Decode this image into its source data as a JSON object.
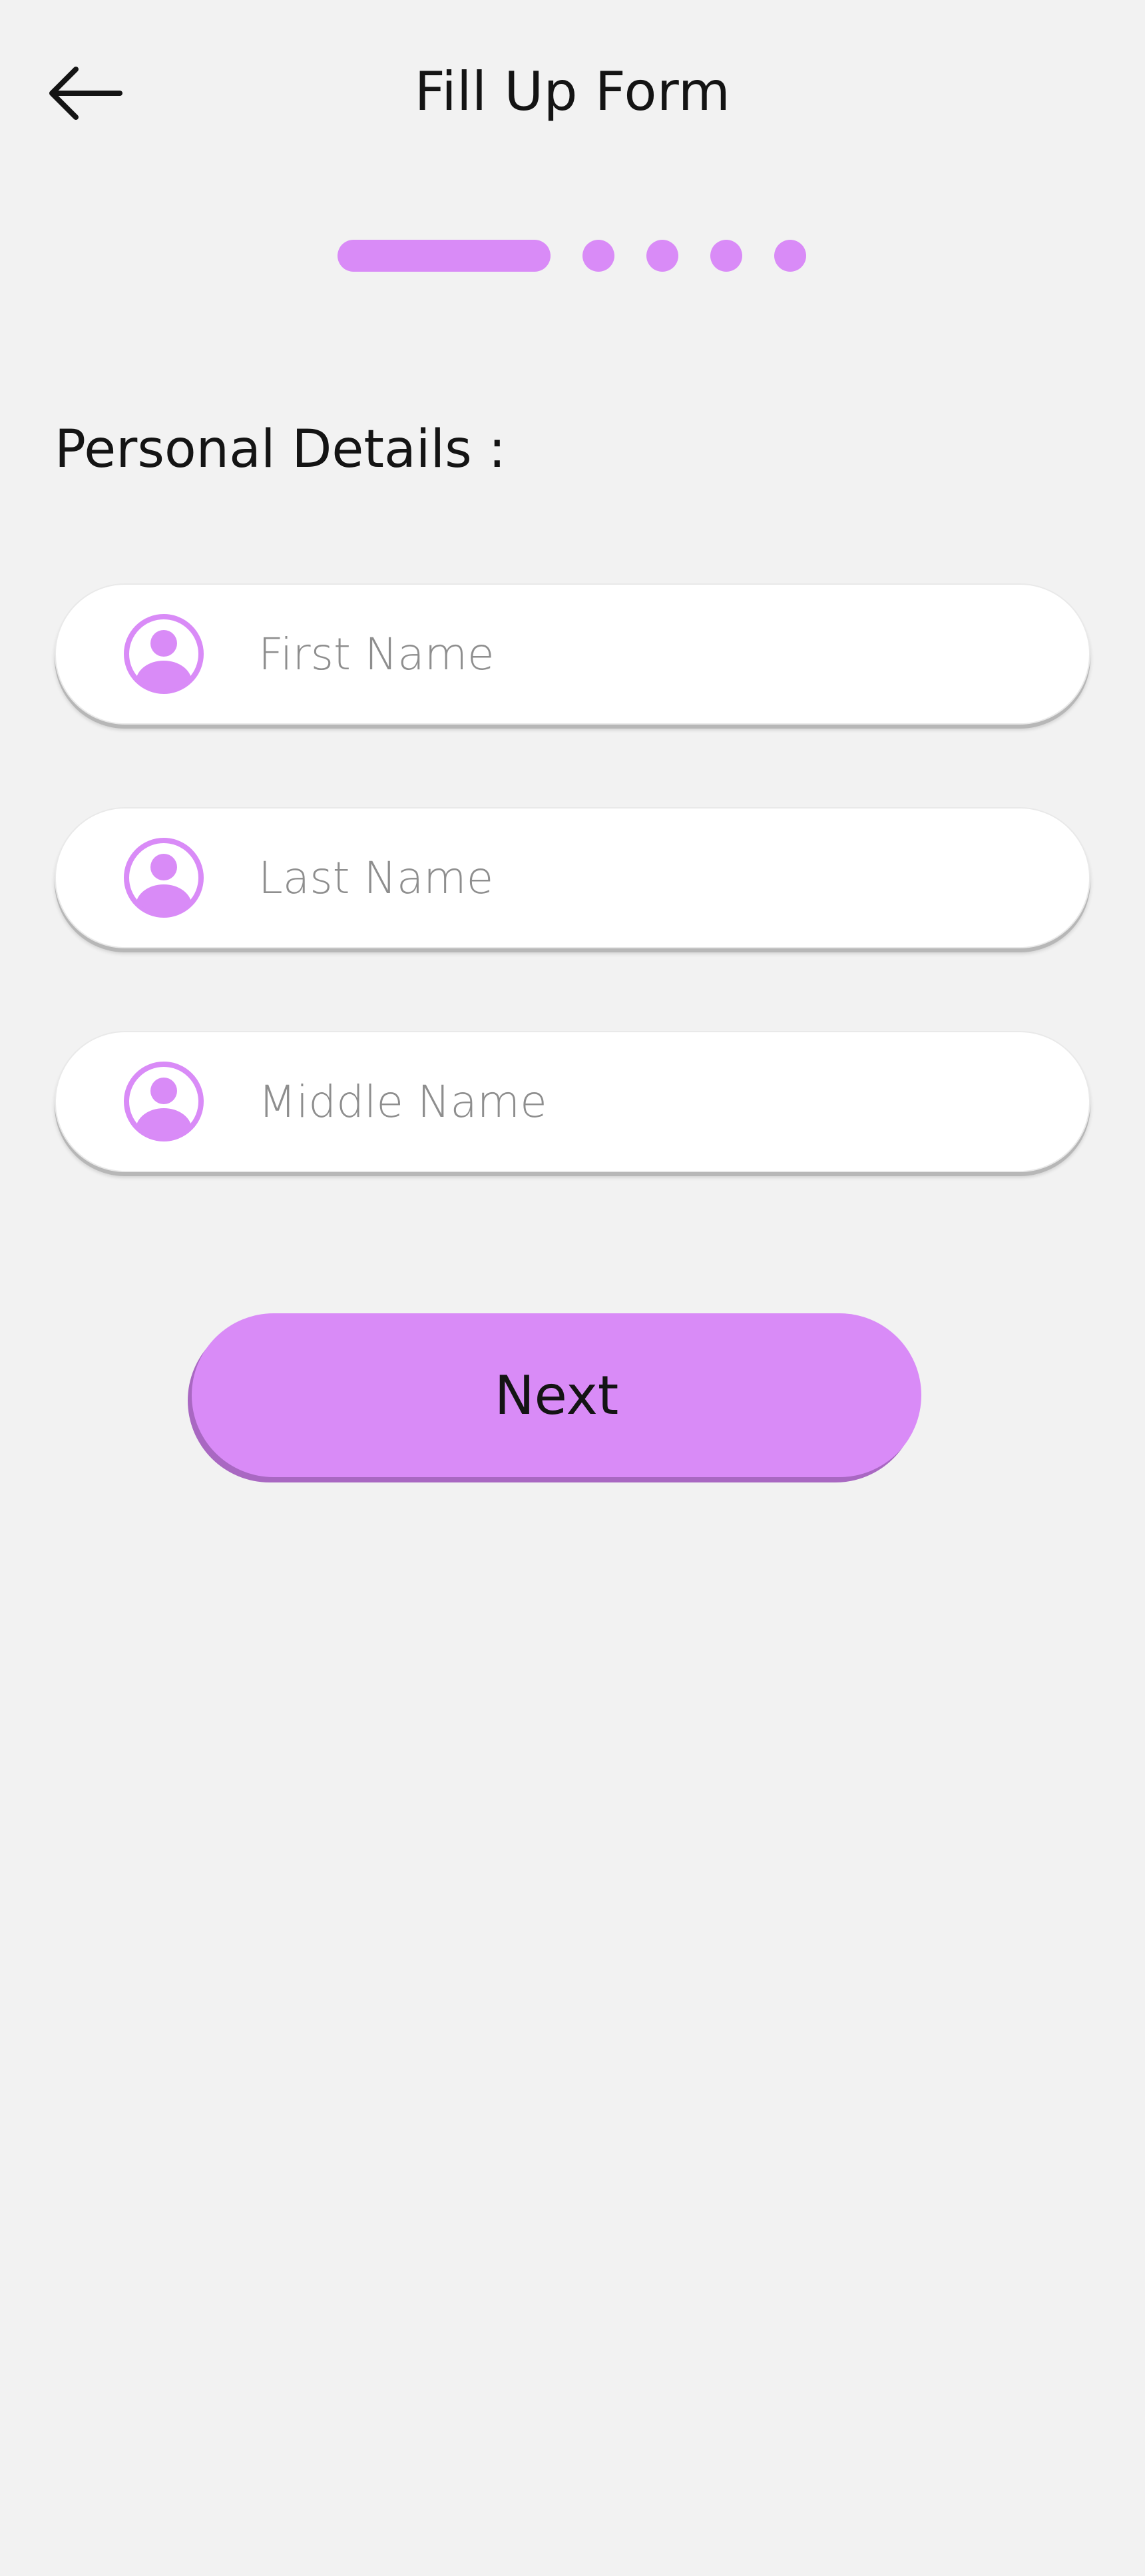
{
  "header": {
    "title": "Fill Up Form",
    "back_icon": "arrow-left-icon"
  },
  "stepper": {
    "total_steps": 5,
    "current_step": 1
  },
  "section": {
    "heading": "Personal Details :"
  },
  "form": {
    "fields": [
      {
        "placeholder": "First Name",
        "value": "",
        "icon": "user-icon"
      },
      {
        "placeholder": "Last Name",
        "value": "",
        "icon": "user-icon"
      },
      {
        "placeholder": "Middle Name",
        "value": "",
        "icon": "user-icon"
      }
    ],
    "next_label": "Next"
  },
  "colors": {
    "accent": "#d98bf7",
    "accent_shadow": "#a968c2",
    "background": "#f2f2f2",
    "field_background": "#ffffff",
    "placeholder": "#8e8e8e",
    "text": "#141414"
  }
}
